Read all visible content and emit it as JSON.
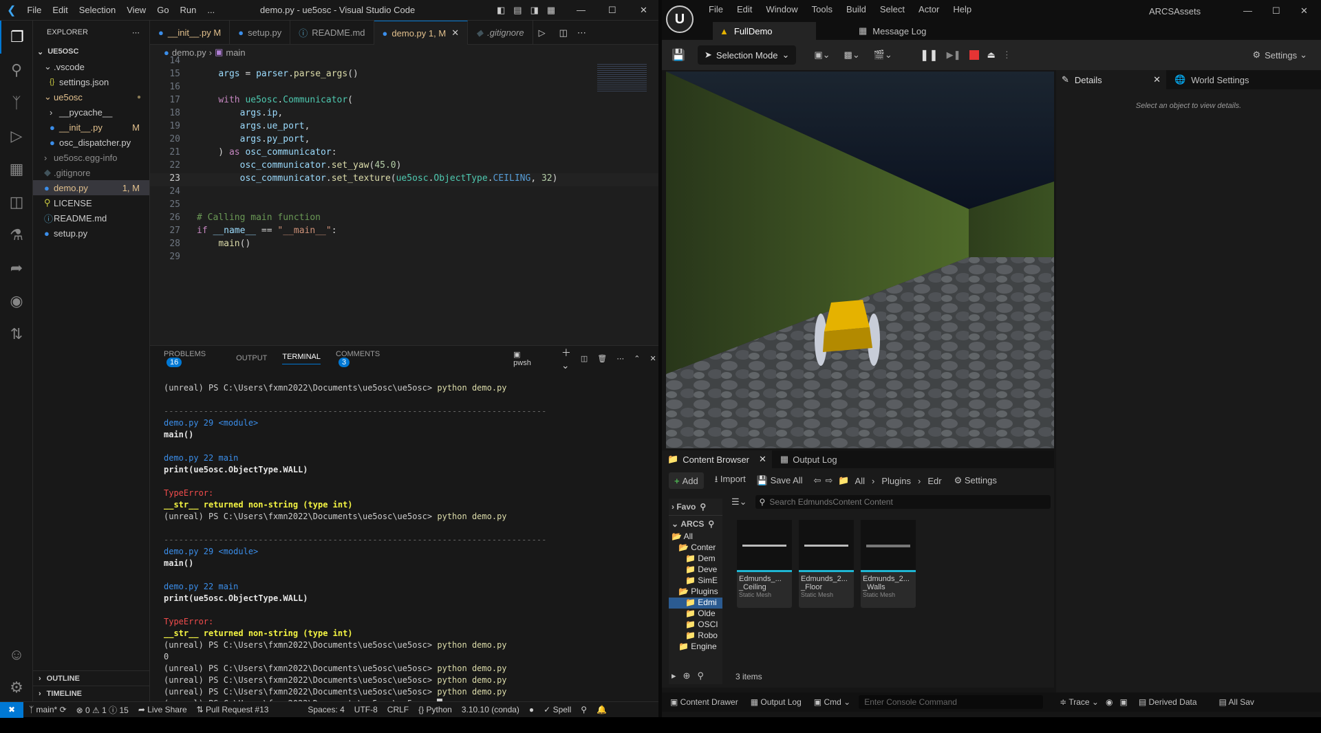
{
  "vscode": {
    "menu": [
      "File",
      "Edit",
      "Selection",
      "View",
      "Go",
      "Run",
      "..."
    ],
    "title": "demo.py - ue5osc - Visual Studio Code",
    "explorer_title": "EXPLORER",
    "root": "UE5OSC",
    "tree": [
      {
        "label": ".vscode",
        "indent": 1,
        "kind": "folder-open"
      },
      {
        "label": "settings.json",
        "indent": 2,
        "kind": "json"
      },
      {
        "label": "ue5osc",
        "indent": 1,
        "kind": "folder-open",
        "status": "●"
      },
      {
        "label": "__pycache__",
        "indent": 2,
        "kind": "folder"
      },
      {
        "label": "__init__.py",
        "indent": 2,
        "kind": "py",
        "status": "M"
      },
      {
        "label": "osc_dispatcher.py",
        "indent": 2,
        "kind": "py"
      },
      {
        "label": "ue5osc.egg-info",
        "indent": 1,
        "kind": "folder"
      },
      {
        "label": ".gitignore",
        "indent": 1,
        "kind": "git"
      },
      {
        "label": "demo.py",
        "indent": 1,
        "kind": "py",
        "status": "1, M",
        "selected": true
      },
      {
        "label": "LICENSE",
        "indent": 1,
        "kind": "lic"
      },
      {
        "label": "README.md",
        "indent": 1,
        "kind": "info"
      },
      {
        "label": "setup.py",
        "indent": 1,
        "kind": "py"
      }
    ],
    "outline": "OUTLINE",
    "timeline": "TIMELINE",
    "tabs": [
      {
        "label": "__init__.py",
        "badge": "M"
      },
      {
        "label": "setup.py",
        "badge": ""
      },
      {
        "label": "README.md",
        "badge": ""
      },
      {
        "label": "demo.py",
        "badge": "1, M",
        "active": true
      },
      {
        "label": ".gitignore",
        "badge": ""
      }
    ],
    "breadcrumb": {
      "file": "demo.py",
      "symbol": "main"
    },
    "panel_tabs": {
      "problems": "PROBLEMS",
      "problems_count": "16",
      "output": "OUTPUT",
      "terminal": "TERMINAL",
      "comments": "COMMENTS",
      "comments_count": "3",
      "shell": "pwsh"
    },
    "status": {
      "branch": "main*",
      "errors": "0",
      "warnings": "1",
      "info": "15",
      "liveshare": "Live Share",
      "pr": "Pull Request #13",
      "spaces": "Spaces: 4",
      "encoding": "UTF-8",
      "eol": "CRLF",
      "lang": "Python",
      "interp": "3.10.10 (conda)",
      "spell": "Spell"
    }
  },
  "terminal": {
    "prompt": "(unreal) PS C:\\Users\\fxmn2022\\Documents\\ue5osc\\ue5osc>",
    "cmd": "python demo.py",
    "sep": "-----------------------------------------------------------------------------",
    "f1": "demo.py 29 <module>",
    "l1": "main()",
    "f2": "demo.py 22 main",
    "l2": "print(ue5osc.ObjectType.WALL)",
    "err": "TypeError:",
    "errmsg": "__str__ returned non-string (type int)",
    "zero": "0"
  },
  "unreal": {
    "menu": [
      "File",
      "Edit",
      "Window",
      "Tools",
      "Build",
      "Select",
      "Actor",
      "Help"
    ],
    "project": "ARCSAssets",
    "tabs": {
      "level": "FullDemo",
      "log": "Message Log"
    },
    "selection_mode": "Selection Mode",
    "settings": "Settings",
    "details": {
      "tab": "Details",
      "world": "World Settings",
      "empty": "Select an object to view details."
    },
    "content": {
      "tab": "Content Browser",
      "output": "Output Log",
      "add": "Add",
      "import": "Import",
      "saveall": "Save All",
      "path": [
        "All",
        "Plugins",
        "Edr"
      ],
      "settings": "Settings",
      "search": "Search EdmundsContent Content",
      "favorites": "Favo",
      "arcs": "ARCS",
      "items": "3 items"
    },
    "ctree": [
      "All",
      "Conter",
      "Dem",
      "Deve",
      "SimE",
      "Plugins",
      "Edmi",
      "Olde",
      "OSCI",
      "Robo",
      "Engine"
    ],
    "assets": [
      {
        "name1": "Edmunds_...",
        "name2": "_Ceiling",
        "type": "Static Mesh"
      },
      {
        "name1": "Edmunds_2...",
        "name2": "_Floor",
        "type": "Static Mesh"
      },
      {
        "name1": "Edmunds_2...",
        "name2": "_Walls",
        "type": "Static Mesh"
      }
    ],
    "bottom": {
      "drawer": "Content Drawer",
      "output": "Output Log",
      "cmd": "Cmd",
      "console": "Enter Console Command",
      "trace": "Trace",
      "ddc": "Derived Data",
      "save": "All Sav"
    }
  },
  "colors": {
    "accent": "#0078d4",
    "ue_yellow": "#e5b200"
  }
}
